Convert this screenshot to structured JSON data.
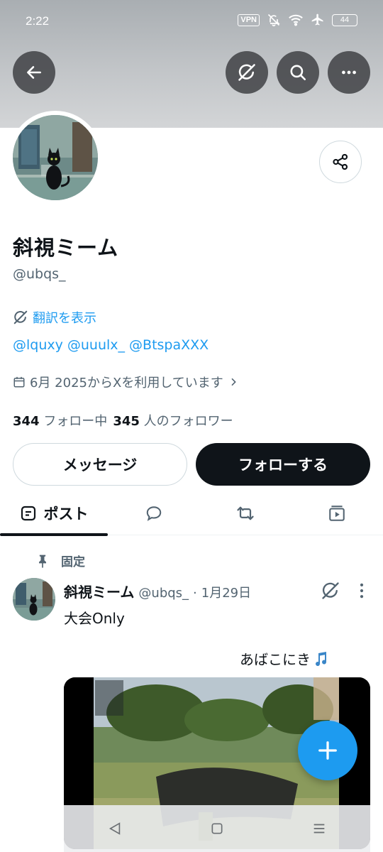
{
  "status_bar": {
    "time": "2:22",
    "vpn": "VPN",
    "battery": "44"
  },
  "header": {
    "back_icon": "arrow-left-icon",
    "grok_icon": "grok-icon",
    "search_icon": "search-icon",
    "more_icon": "more-horizontal-icon"
  },
  "profile": {
    "display_name": "斜視ミーム",
    "handle": "@ubqs_",
    "translate_label": "翻訳を表示",
    "bio_links": [
      "@lquxy",
      "@uuulx_",
      "@BtspaXXX"
    ],
    "joined": "6月 2025からXを利用しています",
    "following_count": "344",
    "following_label": "フォロー中",
    "followers_count": "345",
    "followers_label": "人のフォロワー",
    "message_button": "メッセージ",
    "follow_button": "フォローする"
  },
  "tabs": {
    "posts_label": "ポスト",
    "active": "posts"
  },
  "post": {
    "pinned_label": "固定",
    "author_name": "斜視ミーム",
    "author_handle": "@ubqs_",
    "separator": "·",
    "date": "1月29日",
    "text": "大会Only",
    "text2": "あばこにき",
    "note_icon": "music-note-icon"
  },
  "colors": {
    "accent": "#1d9bf0",
    "text_primary": "#0f1419",
    "text_secondary": "#536471"
  }
}
